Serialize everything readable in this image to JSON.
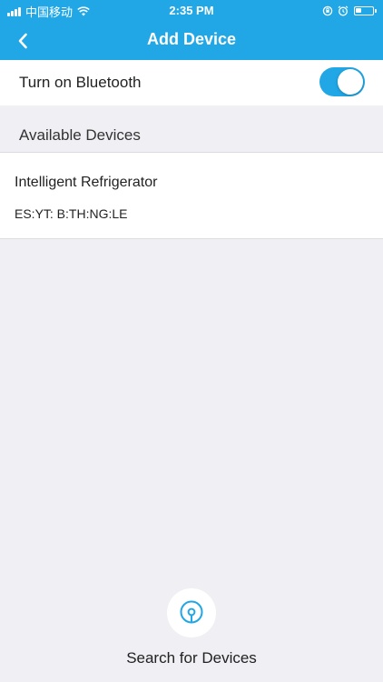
{
  "status_bar": {
    "carrier": "中国移动",
    "time": "2:35 PM",
    "battery_level": 0.35
  },
  "header": {
    "title": "Add Device",
    "back_icon": "chevron-left-icon"
  },
  "bluetooth": {
    "label": "Turn on Bluetooth",
    "enabled": true
  },
  "available_devices": {
    "title": "Available Devices",
    "items": [
      {
        "name": "Intelligent Refrigerator",
        "mac": "ES:YT: B:TH:NG:LE"
      }
    ]
  },
  "search": {
    "label": "Search for Devices",
    "icon": "location-pin-icon"
  },
  "colors": {
    "accent": "#21a7e6",
    "background": "#efeff4"
  }
}
